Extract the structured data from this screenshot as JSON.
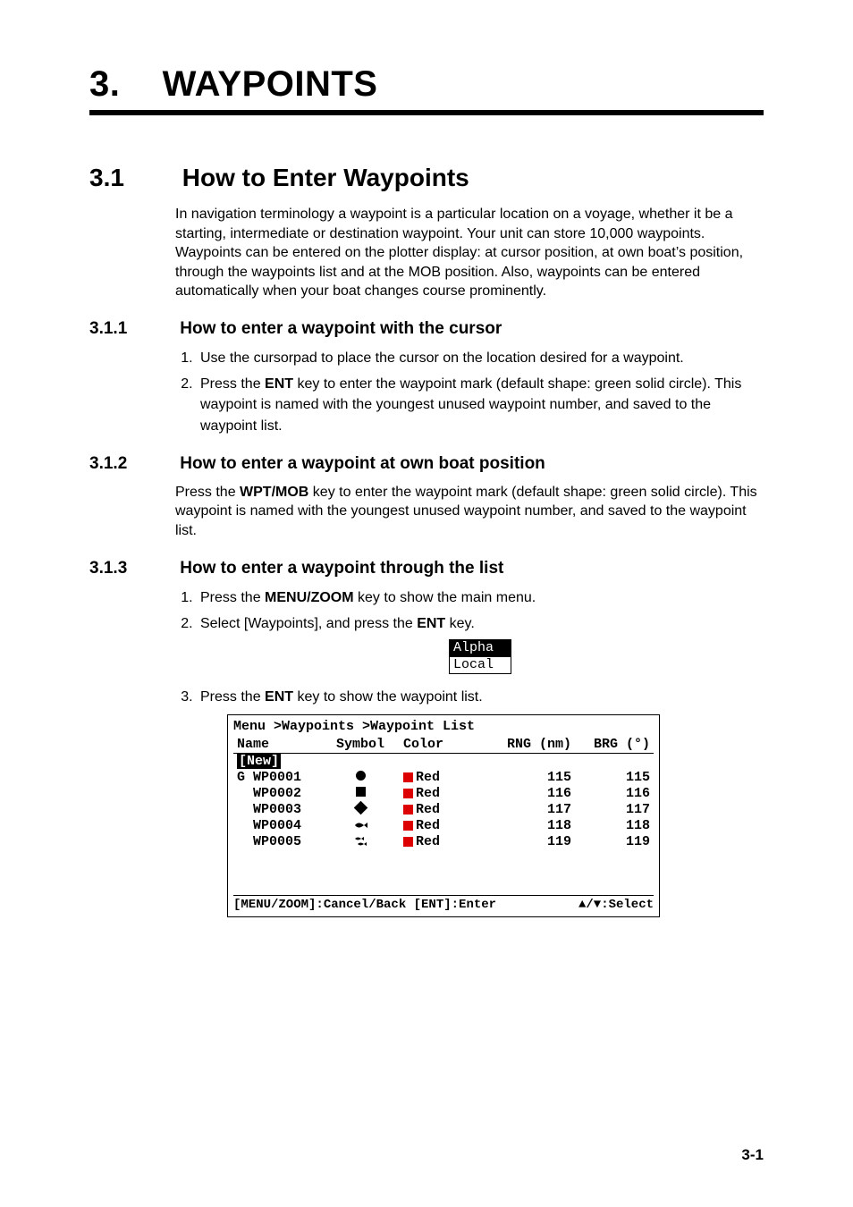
{
  "chapter": {
    "number": "3.",
    "title": "WAYPOINTS"
  },
  "section": {
    "number": "3.1",
    "title": "How to Enter Waypoints",
    "intro": "In navigation terminology a waypoint is a particular location on a voyage, whether it be a starting, intermediate or destination waypoint. Your unit can store 10,000 waypoints. Waypoints can be entered on the plotter display: at cursor position, at own boat’s position, through the waypoints list and at the MOB position. Also, waypoints can be entered automatically when your boat changes course prominently."
  },
  "sub311": {
    "number": "3.1.1",
    "title": "How to enter a waypoint with the cursor",
    "step1": "Use the cursorpad to place the cursor on the location desired for a waypoint.",
    "step2a": "Press the ",
    "step2key": "ENT",
    "step2b": " key to enter the waypoint mark (default shape: green solid circle). This waypoint is named with the youngest unused waypoint number, and saved to the waypoint list."
  },
  "sub312": {
    "number": "3.1.2",
    "title": "How to enter a waypoint at own boat position",
    "p_a": "Press the ",
    "p_key": "WPT/MOB",
    "p_b": " key to enter the waypoint mark (default shape: green solid circle). This waypoint is named with the youngest unused waypoint number, and saved to the waypoint list."
  },
  "sub313": {
    "number": "3.1.3",
    "title": "How to enter a waypoint through the list",
    "s1a": "Press the ",
    "s1key": "MENU/ZOOM",
    "s1b": " key to show the main menu.",
    "s2a": "Select [Waypoints], and press the ",
    "s2key": "ENT",
    "s2b": " key.",
    "s3a": "Press the ",
    "s3key": "ENT",
    "s3b": " key to show the waypoint list."
  },
  "menuFig": {
    "opt1": "Alpha",
    "opt2": "Local"
  },
  "wplist": {
    "crumb": "Menu >Waypoints >Waypoint List",
    "headers": {
      "name": "Name",
      "symbol": "Symbol",
      "color": "Color",
      "rng": "RNG (nm)",
      "brg": "BRG (°)"
    },
    "newLabel": "[New]",
    "rows": [
      {
        "g": "G",
        "name": "WP0001",
        "color": "Red",
        "rng": "115",
        "brg": "115"
      },
      {
        "g": "",
        "name": "WP0002",
        "color": "Red",
        "rng": "116",
        "brg": "116"
      },
      {
        "g": "",
        "name": "WP0003",
        "color": "Red",
        "rng": "117",
        "brg": "117"
      },
      {
        "g": "",
        "name": "WP0004",
        "color": "Red",
        "rng": "118",
        "brg": "118"
      },
      {
        "g": "",
        "name": "WP0005",
        "color": "Red",
        "rng": "119",
        "brg": "119"
      }
    ],
    "footerLeft": "[MENU/ZOOM]:Cancel/Back [ENT]:Enter",
    "footerRight": "▲/▼:Select"
  },
  "pageNumber": "3-1"
}
